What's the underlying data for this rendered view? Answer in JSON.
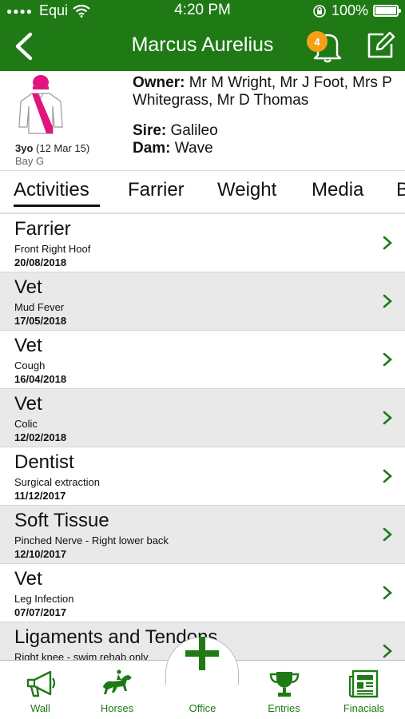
{
  "status_bar": {
    "carrier": "Equi",
    "time": "4:20 PM",
    "battery": "100%"
  },
  "nav": {
    "title": "Marcus Aurelius",
    "notification_count": "4"
  },
  "horse": {
    "age_bold": "3yo",
    "age_date": "(12 Mar 15)",
    "color": "Bay G",
    "owner_label": "Owner:",
    "owner_value": "Mr M Wright, Mr J Foot, Mrs P Whitegrass, Mr D Thomas",
    "sire_label": "Sire:",
    "sire_value": "Galileo",
    "dam_label": "Dam:",
    "dam_value": "Wave"
  },
  "tabs": [
    "Activities",
    "Farrier",
    "Weight",
    "Media",
    "B"
  ],
  "activities": [
    {
      "title": "Farrier",
      "subtitle": "Front Right Hoof",
      "date": "20/08/2018"
    },
    {
      "title": "Vet",
      "subtitle": "Mud Fever",
      "date": "17/05/2018"
    },
    {
      "title": "Vet",
      "subtitle": "Cough",
      "date": "16/04/2018"
    },
    {
      "title": "Vet",
      "subtitle": "Colic",
      "date": "12/02/2018"
    },
    {
      "title": "Dentist",
      "subtitle": "Surgical extraction",
      "date": "11/12/2017"
    },
    {
      "title": "Soft Tissue",
      "subtitle": "Pinched Nerve - Right lower back",
      "date": "12/10/2017"
    },
    {
      "title": "Vet",
      "subtitle": "Leg Infection",
      "date": "07/07/2017"
    },
    {
      "title": "Ligaments and Tendons",
      "subtitle": "Right knee - swim rehab only",
      "date": ""
    }
  ],
  "tabbar": {
    "wall": "Wall",
    "horses": "Horses",
    "office": "Office",
    "entries": "Entries",
    "financials": "Finacials"
  },
  "colors": {
    "brand_green": "#1f7a16",
    "badge_orange": "#f4a019",
    "silks_pink": "#e2137e"
  }
}
